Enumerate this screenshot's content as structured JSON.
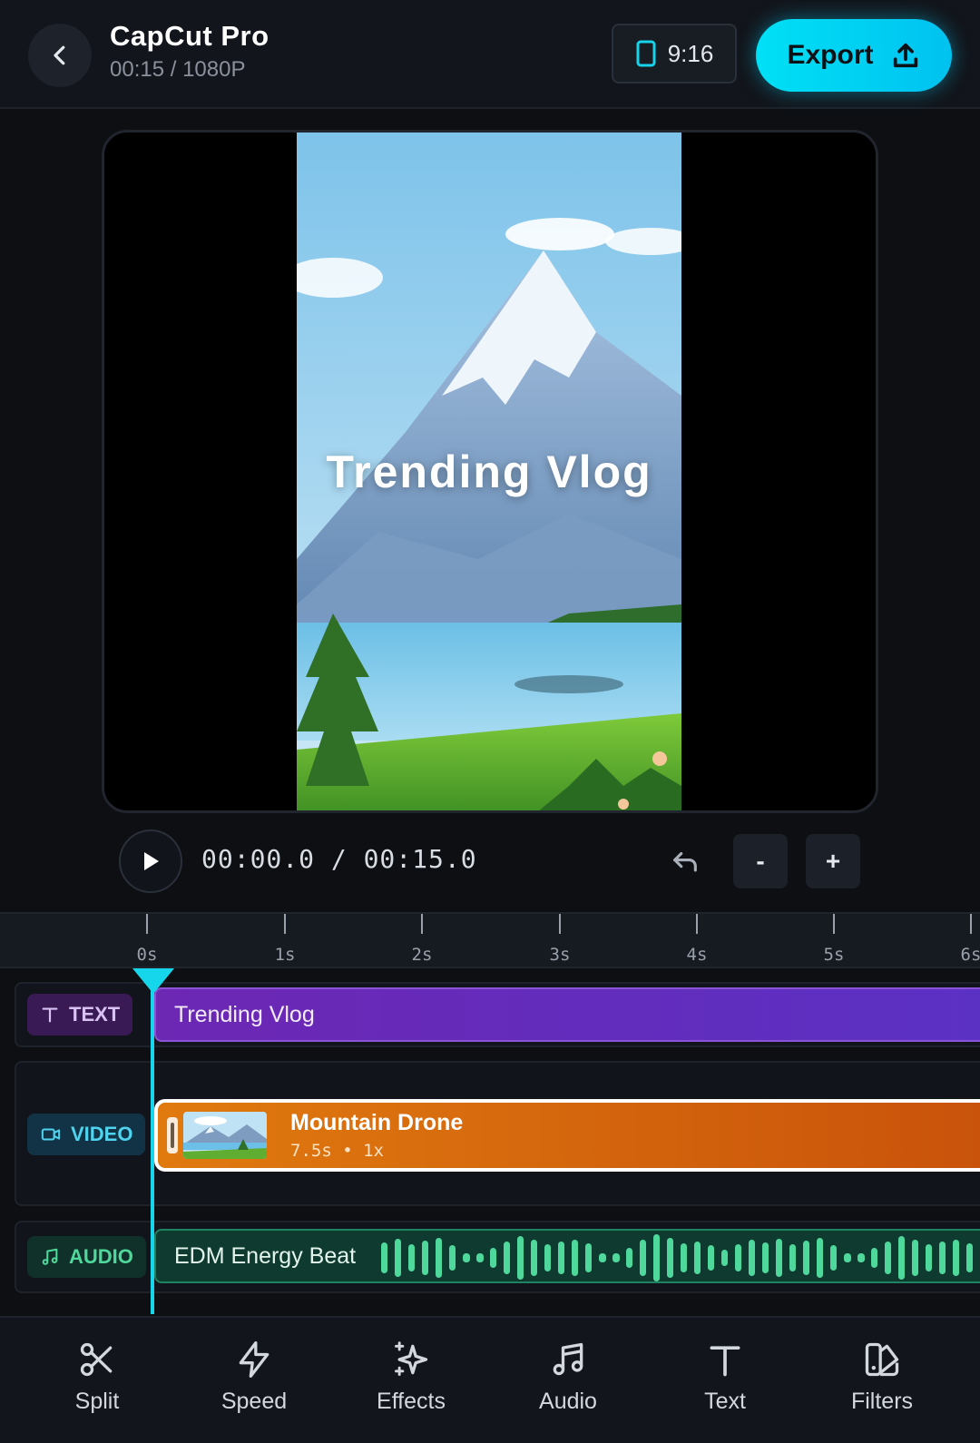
{
  "header": {
    "title": "CapCut Pro",
    "subtitle": "00:15 / 1080P",
    "aspect_ratio": "9:16",
    "export_label": "Export"
  },
  "preview": {
    "overlay_text": "Trending Vlog"
  },
  "playback": {
    "timecode": "00:00.0 / 00:15.0",
    "zoom_out_label": "-",
    "zoom_in_label": "+"
  },
  "timeline": {
    "ticks": [
      "0s",
      "1s",
      "2s",
      "3s",
      "4s",
      "5s",
      "6s"
    ],
    "tracks": {
      "text": {
        "label": "TEXT",
        "clip": "Trending Vlog"
      },
      "video": {
        "label": "VIDEO",
        "clip_title": "Mountain Drone",
        "clip_meta": "7.5s • 1x"
      },
      "audio": {
        "label": "AUDIO",
        "clip": "EDM Energy Beat"
      }
    }
  },
  "toolbar": {
    "split": "Split",
    "speed": "Speed",
    "effects": "Effects",
    "audio": "Audio",
    "text": "Text",
    "filters": "Filters"
  },
  "colors": {
    "accent": "#16d6ec",
    "text_track": "#6c27b3",
    "video_track": "#e07a0f",
    "audio_track": "#4fd89b"
  }
}
